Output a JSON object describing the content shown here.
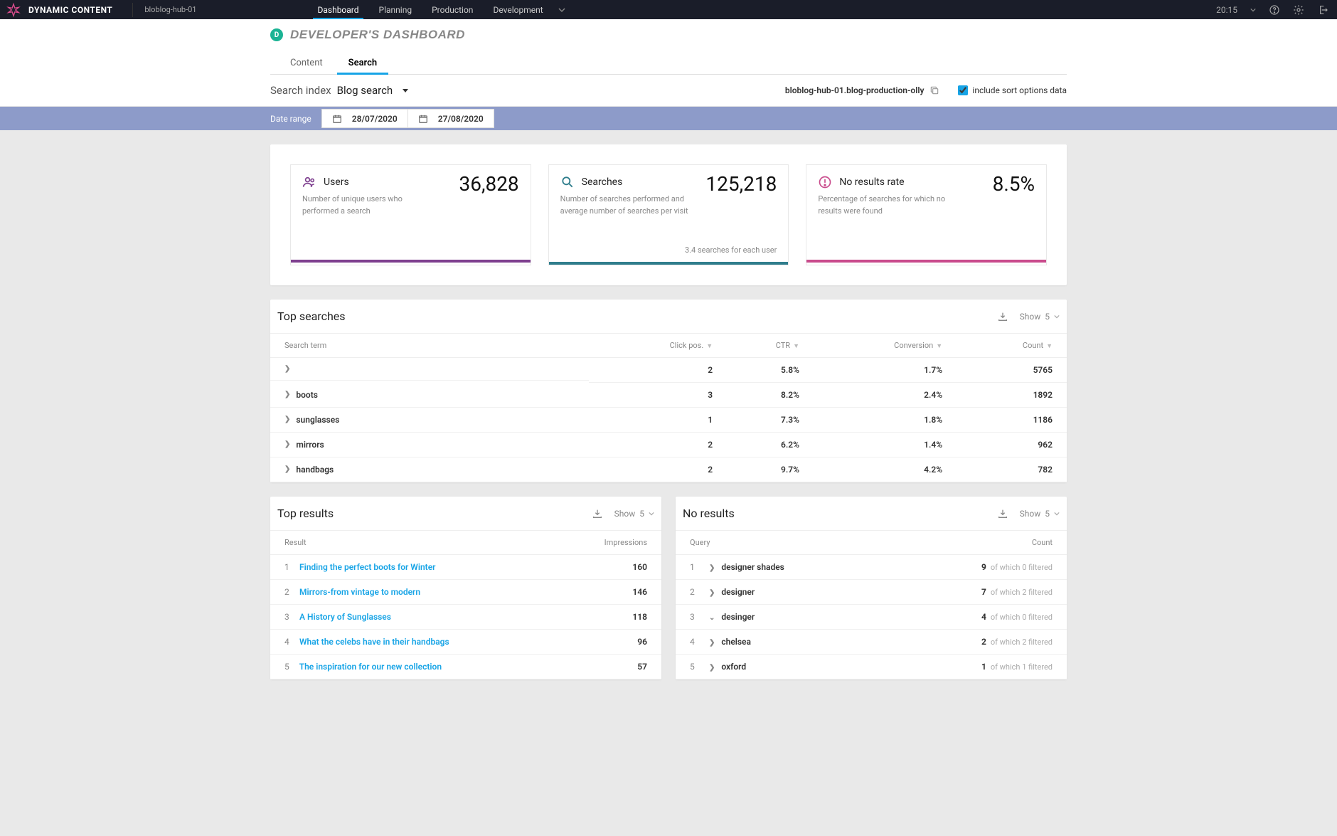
{
  "brand": "DYNAMIC CONTENT",
  "hub": "bloblog-hub-01",
  "nav": {
    "items": [
      "Dashboard",
      "Planning",
      "Production",
      "Development"
    ],
    "active": 0,
    "time": "20:15"
  },
  "page": {
    "badge": "D",
    "title": "DEVELOPER'S DASHBOARD",
    "subtabs": [
      "Content",
      "Search"
    ],
    "active_subtab": 1
  },
  "search_index": {
    "label": "Search index",
    "value": "Blog search",
    "path": "bloblog-hub-01.blog-production-olly",
    "include_sort_label": "include sort options data",
    "include_sort_checked": true
  },
  "date_range": {
    "label": "Date range",
    "from": "28/07/2020",
    "to": "27/08/2020"
  },
  "stats": [
    {
      "icon": "users",
      "color": "#7e3f8f",
      "label": "Users",
      "value": "36,828",
      "desc": "Number of unique users who performed a search",
      "sub": ""
    },
    {
      "icon": "search",
      "color": "#2f7d8c",
      "label": "Searches",
      "value": "125,218",
      "desc": "Number of searches performed and average number of searches per visit",
      "sub": "3.4 searches for each user"
    },
    {
      "icon": "noresults",
      "color": "#c94b8c",
      "label": "No results rate",
      "value": "8.5%",
      "desc": "Percentage of searches for which no results were found",
      "sub": ""
    }
  ],
  "top_searches": {
    "title": "Top searches",
    "show_label": "Show",
    "show_value": "5",
    "headers": [
      "Search term",
      "Click pos.",
      "CTR",
      "Conversion",
      "Count"
    ],
    "rows": [
      {
        "term": "",
        "click_pos": "2",
        "ctr": "5.8%",
        "conv": "1.7%",
        "count": "5765"
      },
      {
        "term": "boots",
        "click_pos": "3",
        "ctr": "8.2%",
        "conv": "2.4%",
        "count": "1892"
      },
      {
        "term": "sunglasses",
        "click_pos": "1",
        "ctr": "7.3%",
        "conv": "1.8%",
        "count": "1186"
      },
      {
        "term": "mirrors",
        "click_pos": "2",
        "ctr": "6.2%",
        "conv": "1.4%",
        "count": "962"
      },
      {
        "term": "handbags",
        "click_pos": "2",
        "ctr": "9.7%",
        "conv": "4.2%",
        "count": "782"
      }
    ]
  },
  "top_results": {
    "title": "Top results",
    "show_label": "Show",
    "show_value": "5",
    "headers": [
      "Result",
      "Impressions"
    ],
    "rows": [
      {
        "n": "1",
        "title": "Finding the perfect boots for Winter",
        "impressions": "160"
      },
      {
        "n": "2",
        "title": "Mirrors-from vintage to modern",
        "impressions": "146"
      },
      {
        "n": "3",
        "title": "A History of Sunglasses",
        "impressions": "118"
      },
      {
        "n": "4",
        "title": "What the celebs have in their handbags",
        "impressions": "96"
      },
      {
        "n": "5",
        "title": "The inspiration for our new collection",
        "impressions": "57"
      }
    ]
  },
  "no_results": {
    "title": "No results",
    "show_label": "Show",
    "show_value": "5",
    "headers": [
      "Query",
      "Count"
    ],
    "filtered_prefix": "of which",
    "filtered_suffix": "filtered",
    "rows": [
      {
        "n": "1",
        "query": "designer shades",
        "count": "9",
        "filtered": "0",
        "expanded": false
      },
      {
        "n": "2",
        "query": "designer",
        "count": "7",
        "filtered": "2",
        "expanded": false
      },
      {
        "n": "3",
        "query": "desinger",
        "count": "4",
        "filtered": "0",
        "expanded": true
      },
      {
        "n": "4",
        "query": "chelsea",
        "count": "2",
        "filtered": "2",
        "expanded": false
      },
      {
        "n": "5",
        "query": "oxford",
        "count": "1",
        "filtered": "1",
        "expanded": false
      }
    ]
  }
}
